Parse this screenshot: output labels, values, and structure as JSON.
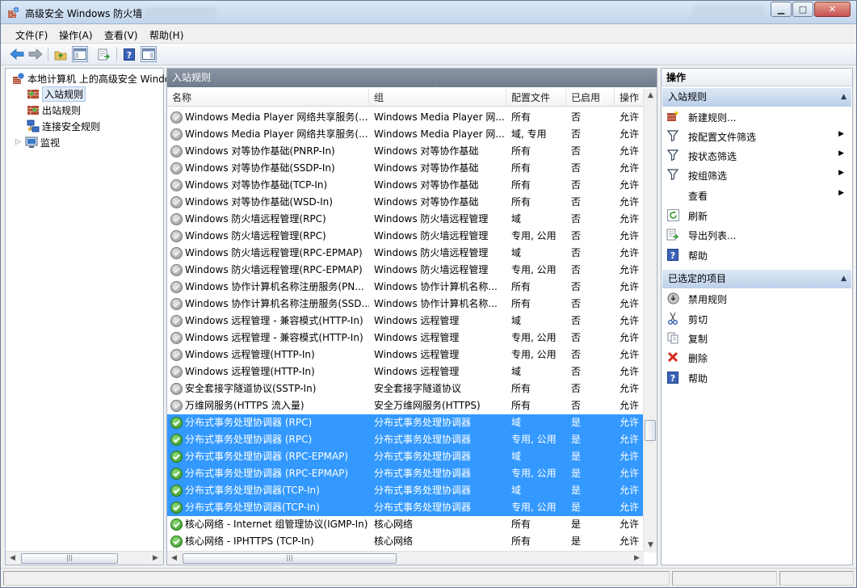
{
  "window": {
    "title": "高级安全 Windows 防火墙",
    "min": "▁",
    "max": "□",
    "close": "✕"
  },
  "menu": [
    "文件(F)",
    "操作(A)",
    "查看(V)",
    "帮助(H)"
  ],
  "tree": {
    "root": "本地计算机 上的高级安全 Windows 防火墙",
    "items": [
      "入站规则",
      "出站规则",
      "连接安全规则",
      "监视"
    ],
    "expander": "▷"
  },
  "scroll": {
    "thumb_grip": "|||"
  },
  "center": {
    "title": "入站规则",
    "columns": [
      "名称",
      "组",
      "配置文件",
      "已启用",
      "操作"
    ],
    "rows": [
      {
        "name": "Windows Media Player 网络共享服务(...",
        "group": "Windows Media Player 网...",
        "profile": "所有",
        "enabled": "否",
        "action": "允许",
        "on": false,
        "sel": false
      },
      {
        "name": "Windows Media Player 网络共享服务(...",
        "group": "Windows Media Player 网...",
        "profile": "域, 专用",
        "enabled": "否",
        "action": "允许",
        "on": false,
        "sel": false
      },
      {
        "name": "Windows 对等协作基础(PNRP-In)",
        "group": "Windows 对等协作基础",
        "profile": "所有",
        "enabled": "否",
        "action": "允许",
        "on": false,
        "sel": false
      },
      {
        "name": "Windows 对等协作基础(SSDP-In)",
        "group": "Windows 对等协作基础",
        "profile": "所有",
        "enabled": "否",
        "action": "允许",
        "on": false,
        "sel": false
      },
      {
        "name": "Windows 对等协作基础(TCP-In)",
        "group": "Windows 对等协作基础",
        "profile": "所有",
        "enabled": "否",
        "action": "允许",
        "on": false,
        "sel": false
      },
      {
        "name": "Windows 对等协作基础(WSD-In)",
        "group": "Windows 对等协作基础",
        "profile": "所有",
        "enabled": "否",
        "action": "允许",
        "on": false,
        "sel": false
      },
      {
        "name": "Windows 防火墙远程管理(RPC)",
        "group": "Windows 防火墙远程管理",
        "profile": "域",
        "enabled": "否",
        "action": "允许",
        "on": false,
        "sel": false
      },
      {
        "name": "Windows 防火墙远程管理(RPC)",
        "group": "Windows 防火墙远程管理",
        "profile": "专用, 公用",
        "enabled": "否",
        "action": "允许",
        "on": false,
        "sel": false
      },
      {
        "name": "Windows 防火墙远程管理(RPC-EPMAP)",
        "group": "Windows 防火墙远程管理",
        "profile": "域",
        "enabled": "否",
        "action": "允许",
        "on": false,
        "sel": false
      },
      {
        "name": "Windows 防火墙远程管理(RPC-EPMAP)",
        "group": "Windows 防火墙远程管理",
        "profile": "专用, 公用",
        "enabled": "否",
        "action": "允许",
        "on": false,
        "sel": false
      },
      {
        "name": "Windows 协作计算机名称注册服务(PN...",
        "group": "Windows 协作计算机名称...",
        "profile": "所有",
        "enabled": "否",
        "action": "允许",
        "on": false,
        "sel": false
      },
      {
        "name": "Windows 协作计算机名称注册服务(SSD...",
        "group": "Windows 协作计算机名称...",
        "profile": "所有",
        "enabled": "否",
        "action": "允许",
        "on": false,
        "sel": false
      },
      {
        "name": "Windows 远程管理 - 兼容模式(HTTP-In)",
        "group": "Windows 远程管理",
        "profile": "域",
        "enabled": "否",
        "action": "允许",
        "on": false,
        "sel": false
      },
      {
        "name": "Windows 远程管理 - 兼容模式(HTTP-In)",
        "group": "Windows 远程管理",
        "profile": "专用, 公用",
        "enabled": "否",
        "action": "允许",
        "on": false,
        "sel": false
      },
      {
        "name": "Windows 远程管理(HTTP-In)",
        "group": "Windows 远程管理",
        "profile": "专用, 公用",
        "enabled": "否",
        "action": "允许",
        "on": false,
        "sel": false
      },
      {
        "name": "Windows 远程管理(HTTP-In)",
        "group": "Windows 远程管理",
        "profile": "域",
        "enabled": "否",
        "action": "允许",
        "on": false,
        "sel": false
      },
      {
        "name": "安全套接字隧道协议(SSTP-In)",
        "group": "安全套接字隧道协议",
        "profile": "所有",
        "enabled": "否",
        "action": "允许",
        "on": false,
        "sel": false
      },
      {
        "name": "万维网服务(HTTPS 流入量)",
        "group": "安全万维网服务(HTTPS)",
        "profile": "所有",
        "enabled": "否",
        "action": "允许",
        "on": false,
        "sel": false
      },
      {
        "name": "分布式事务处理协调器 (RPC)",
        "group": "分布式事务处理协调器",
        "profile": "域",
        "enabled": "是",
        "action": "允许",
        "on": true,
        "sel": true
      },
      {
        "name": "分布式事务处理协调器 (RPC)",
        "group": "分布式事务处理协调器",
        "profile": "专用, 公用",
        "enabled": "是",
        "action": "允许",
        "on": true,
        "sel": true
      },
      {
        "name": "分布式事务处理协调器 (RPC-EPMAP)",
        "group": "分布式事务处理协调器",
        "profile": "域",
        "enabled": "是",
        "action": "允许",
        "on": true,
        "sel": true
      },
      {
        "name": "分布式事务处理协调器 (RPC-EPMAP)",
        "group": "分布式事务处理协调器",
        "profile": "专用, 公用",
        "enabled": "是",
        "action": "允许",
        "on": true,
        "sel": true
      },
      {
        "name": "分布式事务处理协调器(TCP-In)",
        "group": "分布式事务处理协调器",
        "profile": "域",
        "enabled": "是",
        "action": "允许",
        "on": true,
        "sel": true
      },
      {
        "name": "分布式事务处理协调器(TCP-In)",
        "group": "分布式事务处理协调器",
        "profile": "专用, 公用",
        "enabled": "是",
        "action": "允许",
        "on": true,
        "sel": true
      },
      {
        "name": "核心网络 - Internet 组管理协议(IGMP-In)",
        "group": "核心网络",
        "profile": "所有",
        "enabled": "是",
        "action": "允许",
        "on": true,
        "sel": false
      },
      {
        "name": "核心网络 - IPHTTPS (TCP-In)",
        "group": "核心网络",
        "profile": "所有",
        "enabled": "是",
        "action": "允许",
        "on": true,
        "sel": false
      }
    ]
  },
  "actions": {
    "title": "操作",
    "section1": "入站规则",
    "items1": [
      "新建规则...",
      "按配置文件筛选",
      "按状态筛选",
      "按组筛选",
      "查看",
      "刷新",
      "导出列表...",
      "帮助"
    ],
    "section2": "已选定的项目",
    "items2": [
      "禁用规则",
      "剪切",
      "复制",
      "删除",
      "帮助"
    ],
    "submenu_arrow": "▶",
    "collapse_caret": "▲"
  },
  "colors": {
    "selection": "#3399ff",
    "pane_title": "#7a8595",
    "section": "#c7d8ee"
  }
}
